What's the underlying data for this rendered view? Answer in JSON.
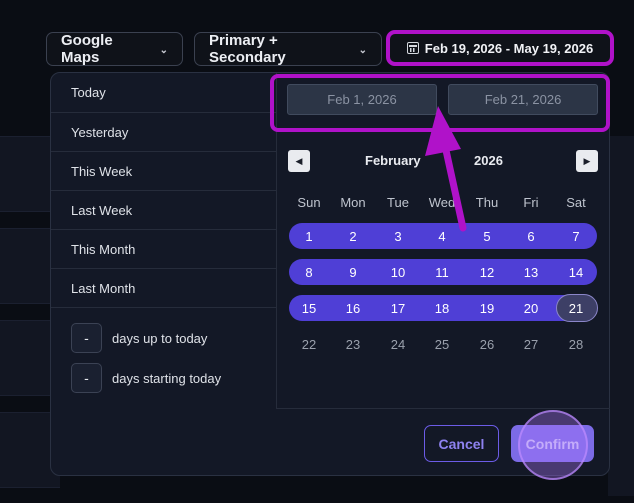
{
  "toolbar": {
    "source_label": "Google Maps",
    "result_type_label": "Primary + Secondary",
    "date_range_label": "Feb 19, 2026 - May 19, 2026"
  },
  "presets": {
    "items": [
      "Today",
      "Yesterday",
      "This Week",
      "Last Week",
      "This Month",
      "Last Month"
    ],
    "days_up_to_today": {
      "value": "-",
      "label": "days up to today"
    },
    "days_starting_today": {
      "value": "-",
      "label": "days starting today"
    }
  },
  "range": {
    "start_placeholder": "Feb 1, 2026",
    "end_placeholder": "Feb 21, 2026"
  },
  "calendar": {
    "month": "February",
    "year": "2026",
    "weekdays": [
      "Sun",
      "Mon",
      "Tue",
      "Wed",
      "Thu",
      "Fri",
      "Sat"
    ],
    "weeks": [
      [
        "1",
        "2",
        "3",
        "4",
        "5",
        "6",
        "7"
      ],
      [
        "8",
        "9",
        "10",
        "11",
        "12",
        "13",
        "14"
      ],
      [
        "15",
        "16",
        "17",
        "18",
        "19",
        "20",
        "21"
      ],
      [
        "22",
        "23",
        "24",
        "25",
        "26",
        "27",
        "28"
      ]
    ],
    "highlighted_weeks": 3,
    "hovered_day": "21"
  },
  "actions": {
    "cancel_label": "Cancel",
    "confirm_label": "Confirm"
  },
  "colors": {
    "accent": "#4f3fd6",
    "annotation": "#b012c9"
  }
}
